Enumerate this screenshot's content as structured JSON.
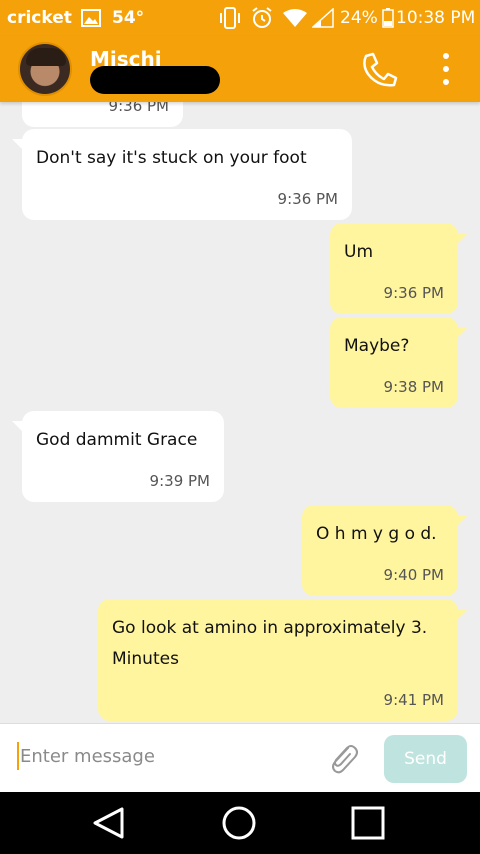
{
  "status_bar": {
    "carrier": "cricket",
    "temperature": "54°",
    "battery": "24%",
    "time": "10:38 PM"
  },
  "header": {
    "contact_name": "Mischi"
  },
  "messages": [
    {
      "direction": "in",
      "time": "9:36 PM",
      "partially_visible": true
    },
    {
      "direction": "in",
      "text": "Don't say it's stuck on your foot",
      "time": "9:36 PM"
    },
    {
      "direction": "out",
      "text": "Um",
      "time": "9:36 PM"
    },
    {
      "direction": "out",
      "text": "Maybe?",
      "time": "9:38 PM"
    },
    {
      "direction": "in",
      "text": "God dammit Grace",
      "time": "9:39 PM"
    },
    {
      "direction": "out",
      "text": "O h m y g o d.",
      "time": "9:40 PM"
    },
    {
      "direction": "out",
      "text": "Go look at amino in approximately 3. Minutes",
      "time": "9:41 PM"
    }
  ],
  "composer": {
    "placeholder": "Enter message",
    "send_label": "Send"
  },
  "colors": {
    "accent": "#f5a20a",
    "outgoing_bubble": "#fff59e",
    "incoming_bubble": "#ffffff",
    "send_button": "#bfe3df"
  }
}
